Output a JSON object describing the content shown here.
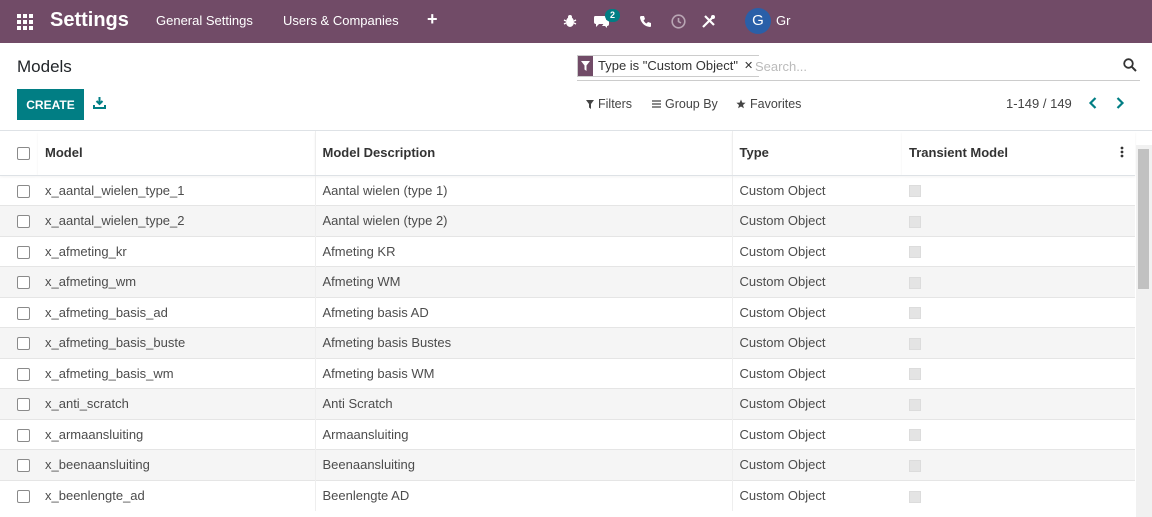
{
  "navbar": {
    "app_name": "Settings",
    "menu": [
      "General Settings",
      "Users & Companies"
    ],
    "quick_create_label": "+",
    "messages_count": "2",
    "user_initial": "G",
    "user_name": "Gr",
    "background_color": "#714b67"
  },
  "control_panel": {
    "title": "Models",
    "create_label": "CREATE",
    "search": {
      "facet_label": "Type is \"Custom Object\"",
      "placeholder": "Search..."
    },
    "filters_label": "Filters",
    "group_by_label": "Group By",
    "favorites_label": "Favorites",
    "pager": "1-149 / 149",
    "accent_color": "#017e84"
  },
  "list": {
    "columns": [
      "Model",
      "Model Description",
      "Type",
      "Transient Model"
    ],
    "rows": [
      {
        "model": "x_aantal_wielen_type_1",
        "description": "Aantal wielen (type 1)",
        "type": "Custom Object",
        "transient": false
      },
      {
        "model": "x_aantal_wielen_type_2",
        "description": "Aantal wielen (type 2)",
        "type": "Custom Object",
        "transient": false
      },
      {
        "model": "x_afmeting_kr",
        "description": "Afmeting KR",
        "type": "Custom Object",
        "transient": false
      },
      {
        "model": "x_afmeting_wm",
        "description": "Afmeting WM",
        "type": "Custom Object",
        "transient": false
      },
      {
        "model": "x_afmeting_basis_ad",
        "description": "Afmeting basis AD",
        "type": "Custom Object",
        "transient": false
      },
      {
        "model": "x_afmeting_basis_buste",
        "description": "Afmeting basis Bustes",
        "type": "Custom Object",
        "transient": false
      },
      {
        "model": "x_afmeting_basis_wm",
        "description": "Afmeting basis WM",
        "type": "Custom Object",
        "transient": false
      },
      {
        "model": "x_anti_scratch",
        "description": "Anti Scratch",
        "type": "Custom Object",
        "transient": false
      },
      {
        "model": "x_armaansluiting",
        "description": "Armaansluiting",
        "type": "Custom Object",
        "transient": false
      },
      {
        "model": "x_beenaansluiting",
        "description": "Beenaansluiting",
        "type": "Custom Object",
        "transient": false
      },
      {
        "model": "x_beenlengte_ad",
        "description": "Beenlengte AD",
        "type": "Custom Object",
        "transient": false
      }
    ]
  }
}
